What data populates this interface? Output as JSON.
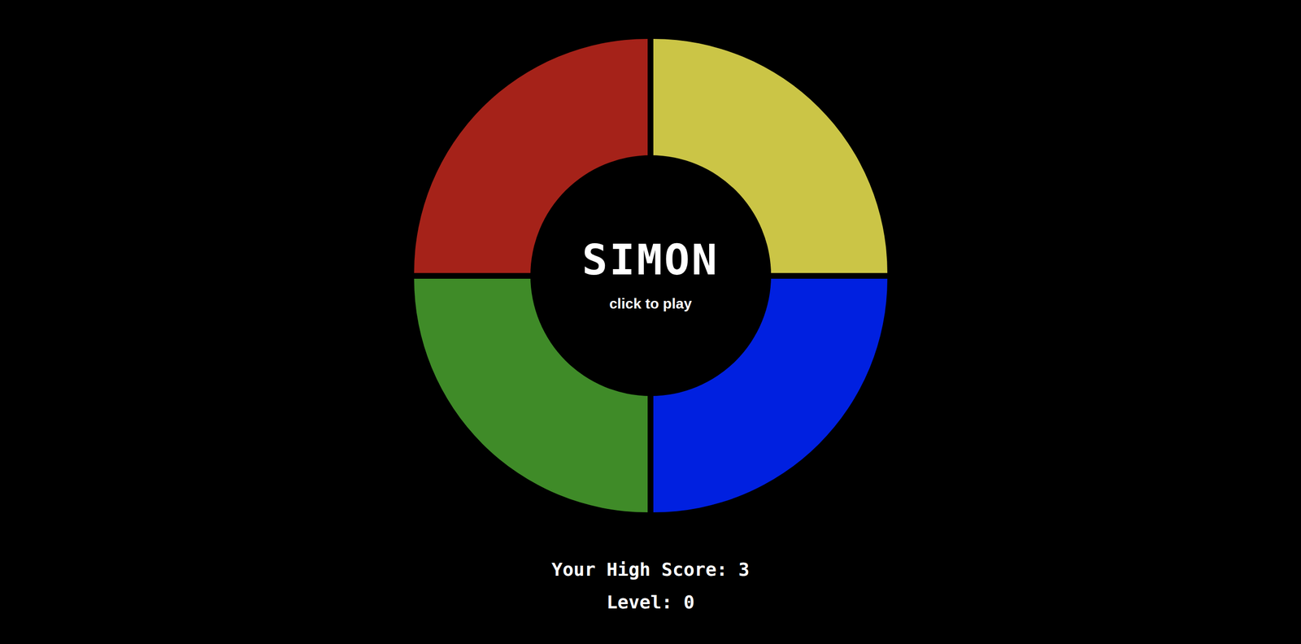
{
  "title": "SIMON",
  "prompt": "click to play",
  "pads": [
    {
      "color": "#a52219"
    },
    {
      "color": "#cbc546"
    },
    {
      "color": "#3f8b28"
    },
    {
      "color": "#0020e0"
    }
  ],
  "high_score": "Your High Score: 3",
  "level": "Level: 0"
}
